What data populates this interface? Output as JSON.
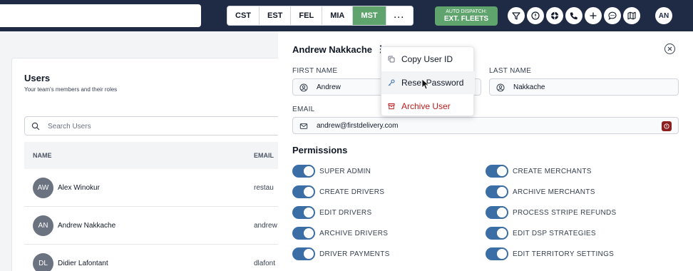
{
  "topbar": {
    "timezones": [
      "CST",
      "EST",
      "FEL",
      "MIA",
      "MST",
      "..."
    ],
    "active_timezone": "MST",
    "dispatch_small": "AUTO DISPATCH:",
    "dispatch_big": "EXT. FLEETS",
    "icons": [
      "filter-icon",
      "alert-icon",
      "lifebuoy-icon",
      "phone-icon",
      "plus-icon",
      "chat-icon",
      "map-icon"
    ],
    "user_initials": "AN",
    "accent_color": "#5fa36d"
  },
  "users": {
    "title": "Users",
    "subtitle": "Your team's members and their roles",
    "search_placeholder": "Search Users",
    "columns": [
      "NAME",
      "EMAIL"
    ],
    "rows": [
      {
        "initials": "AW",
        "name": "Alex Winokur",
        "email": "restau"
      },
      {
        "initials": "AN",
        "name": "Andrew Nakkache",
        "email": "andrew"
      },
      {
        "initials": "DL",
        "name": "Didier Lafontant",
        "email": "dlafont"
      }
    ]
  },
  "detail": {
    "name": "Andrew Nakkache",
    "first_name_label": "FIRST NAME",
    "first_name": "Andrew",
    "last_name_label": "LAST NAME",
    "last_name": "Nakkache",
    "email_label": "EMAIL",
    "email": "andrew@firstdelivery.com",
    "permissions_title": "Permissions",
    "permissions_left": [
      "SUPER ADMIN",
      "CREATE DRIVERS",
      "EDIT DRIVERS",
      "ARCHIVE DRIVERS",
      "DRIVER PAYMENTS"
    ],
    "permissions_right": [
      "CREATE MERCHANTS",
      "ARCHIVE MERCHANTS",
      "PROCESS STRIPE REFUNDS",
      "EDIT DSP STRATEGIES",
      "EDIT TERRITORY SETTINGS"
    ]
  },
  "menu": {
    "items": [
      "Copy User ID",
      "Reset Password",
      "Archive User"
    ],
    "danger_color": "#b91c1c"
  }
}
